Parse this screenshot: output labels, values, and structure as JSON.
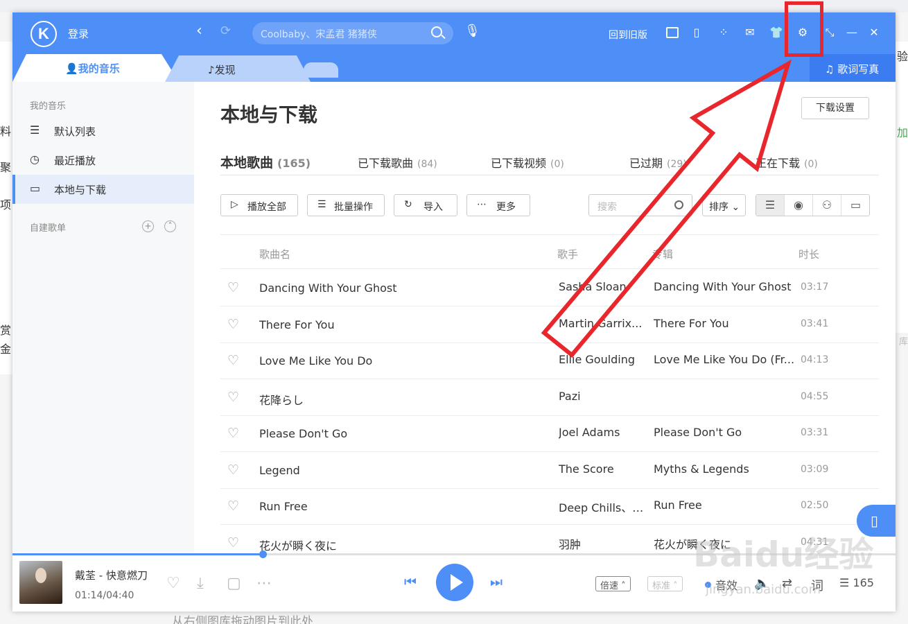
{
  "header": {
    "logo": "K",
    "login": "登录",
    "search_placeholder": "Coolbaby、宋孟君 猪猪侠",
    "old_version": "回到旧版",
    "tabs": {
      "my_music": "我的音乐",
      "discover": "发现"
    },
    "lyrics_photo": "歌词写真"
  },
  "sidebar": {
    "section_my_music": "我的音乐",
    "items": [
      {
        "label": "默认列表",
        "icon": "playlist-icon"
      },
      {
        "label": "最近播放",
        "icon": "clock-icon"
      },
      {
        "label": "本地与下载",
        "icon": "monitor-icon"
      }
    ],
    "section_playlists": "自建歌单"
  },
  "main": {
    "title": "本地与下载",
    "download_settings": "下载设置",
    "tabs": [
      {
        "label": "本地歌曲",
        "count": "(165)"
      },
      {
        "label": "已下载歌曲",
        "count": "(84)"
      },
      {
        "label": "已下载视频",
        "count": "(0)"
      },
      {
        "label": "已过期",
        "count": "(29)"
      },
      {
        "label": "正在下载",
        "count": "(0)"
      }
    ],
    "toolbar": {
      "play_all": "播放全部",
      "batch": "批量操作",
      "import": "导入",
      "more": "更多",
      "search_placeholder": "搜索",
      "sort": "排序"
    },
    "columns": {
      "song": "歌曲名",
      "artist": "歌手",
      "album": "专辑",
      "duration": "时长"
    },
    "songs": [
      {
        "title": "Dancing With Your Ghost",
        "artist": "Sasha Sloan",
        "album": "Dancing With Your Ghost",
        "duration": "03:17"
      },
      {
        "title": "There For You",
        "artist": "Martin Garrix...",
        "album": "There For You",
        "duration": "03:41"
      },
      {
        "title": "Love Me Like You Do",
        "artist": "Ellie Goulding",
        "album": "Love Me Like You Do (Fr...",
        "duration": "04:13"
      },
      {
        "title": "花降らし",
        "artist": "Pazi",
        "album": "",
        "duration": "04:55"
      },
      {
        "title": "Please Don't Go",
        "artist": "Joel Adams",
        "album": "Please Don't Go",
        "duration": "03:31"
      },
      {
        "title": "Legend",
        "artist": "The Score",
        "album": "Myths & Legends",
        "duration": "03:09"
      },
      {
        "title": "Run Free",
        "artist": "Deep Chills、I...",
        "album": "Run Free",
        "duration": "02:50"
      },
      {
        "title": "花火が瞬く夜に",
        "artist": "羽肿",
        "album": "花火が瞬く夜に",
        "duration": "04:31"
      }
    ]
  },
  "player": {
    "now_playing": "戴荃 - 快意燃刀",
    "time": "01:14/04:40",
    "progress": 0.2833,
    "speed": "倍速",
    "quality": "标准",
    "effect": "音效",
    "lyrics": "词",
    "queue_count": "165"
  },
  "background": {
    "left_chars": [
      "料",
      "聚",
      "项",
      "赏",
      "金"
    ],
    "right_chars": [
      "验",
      "加",
      "库"
    ],
    "bottom_hint": "从右侧图库拖动图片到此处"
  },
  "watermark": {
    "brand": "Baidu经验",
    "url": "jingyan.baidu.com"
  },
  "colors": {
    "accent": "#4d8ef7",
    "annotation": "#e8262c"
  }
}
